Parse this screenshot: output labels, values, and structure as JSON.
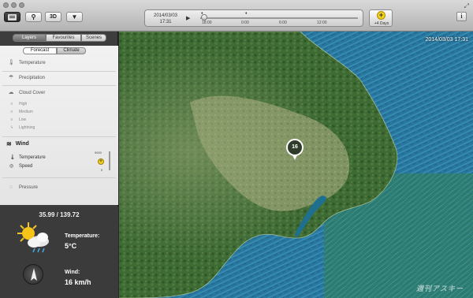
{
  "toolbar": {
    "view_2d_icon": "list-view-icon",
    "pin_icon": "pin-icon",
    "btn_3d": "3D",
    "torch_icon": "torch-icon",
    "date": "2014/03/03",
    "time": "17:31",
    "play_icon": "play-icon",
    "ticks": [
      "18:00",
      "0:00",
      "6:00",
      "12:00"
    ],
    "plus_days": "+4 Days",
    "info": "i"
  },
  "sidebar": {
    "tabs": [
      "Layers",
      "Favourites",
      "Scenes"
    ],
    "active_tab": "Layers",
    "mode_tabs": [
      "Forecast",
      "Climate"
    ],
    "active_mode": "Forecast",
    "layers": [
      {
        "label": "Temperature",
        "icon": "thermometer-icon"
      },
      {
        "label": "Precipitation",
        "icon": "rain-icon"
      },
      {
        "label": "Cloud Cover",
        "icon": "cloud-icon"
      }
    ],
    "cloud_sub": [
      "High",
      "Medium",
      "Low",
      "Lightning"
    ],
    "wind": {
      "label": "Wind",
      "icon": "wind-icon",
      "sub": [
        "Temperature",
        "Speed"
      ],
      "altitude_top": "9000",
      "altitude_bottom": "0"
    },
    "pressure": {
      "label": "Pressure",
      "icon": "pressure-icon"
    }
  },
  "weather": {
    "coords": "35.99 / 139.72",
    "temp_label": "Temperature:",
    "temp_value": "5°C",
    "wind_label": "Wind:",
    "wind_value": "16 km/h",
    "condition_icon": "sun-cloud-rain-icon",
    "compass_icon": "wind-direction-arrow-icon"
  },
  "map": {
    "timestamp": "2014/03/03 17:31",
    "pin_value": "16",
    "watermark": "週刊アスキー"
  }
}
